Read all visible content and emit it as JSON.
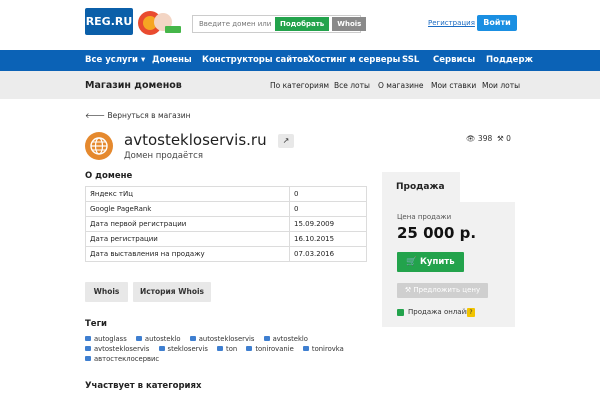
{
  "header": {
    "logo_text": "REG.RU",
    "search_placeholder": "Введите домен или",
    "pick_button": "Подобрать",
    "whois_button": "Whois",
    "register_link": "Регистрация",
    "login_button": "Войти"
  },
  "nav": {
    "items": [
      "Все услуги ▾",
      "Домены",
      "Конструкторы сайтов",
      "Хостинг и серверы",
      "SSL",
      "Сервисы",
      "Поддерж"
    ]
  },
  "subnav": {
    "title": "Магазин доменов",
    "links": [
      "По категориям",
      "Все лоты",
      "О магазине",
      "Мои ставки",
      "Мои лоты"
    ]
  },
  "back_link": "Вернуться в магазин",
  "domain": {
    "name": "avtostekloservis.ru",
    "status": "Домен продаётся",
    "views": "398",
    "bids": "0"
  },
  "about": {
    "title": "О домене",
    "rows": [
      {
        "label": "Яндекс тИц",
        "value": "0"
      },
      {
        "label": "Google PageRank",
        "value": "0"
      },
      {
        "label": "Дата первой регистрации",
        "value": "15.09.2009"
      },
      {
        "label": "Дата регистрации",
        "value": "16.10.2015"
      },
      {
        "label": "Дата выставления на продажу",
        "value": "07.03.2016"
      }
    ]
  },
  "buttons": {
    "whois": "Whois",
    "history": "История Whois"
  },
  "tags": {
    "title": "Теги",
    "items": [
      "autoglass",
      "autosteklo",
      "autostekloservis",
      "avtosteklo",
      "avtostekloservis",
      "stekloservis",
      "ton",
      "tonirovanie",
      "tonirovka",
      "автостеклосервис"
    ]
  },
  "categories_title": "Участвует в категориях",
  "sale": {
    "tab": "Продажа",
    "price_label": "Цена продажи",
    "price": "25 000 р.",
    "buy_button": "Купить",
    "offer_button": "Предложить цену",
    "online_label": "Продажа онлайн",
    "help": "?"
  },
  "colors": {
    "nav_blue": "#0b62b6",
    "accent_green": "#23a34c",
    "link_blue": "#1a6bc3"
  }
}
